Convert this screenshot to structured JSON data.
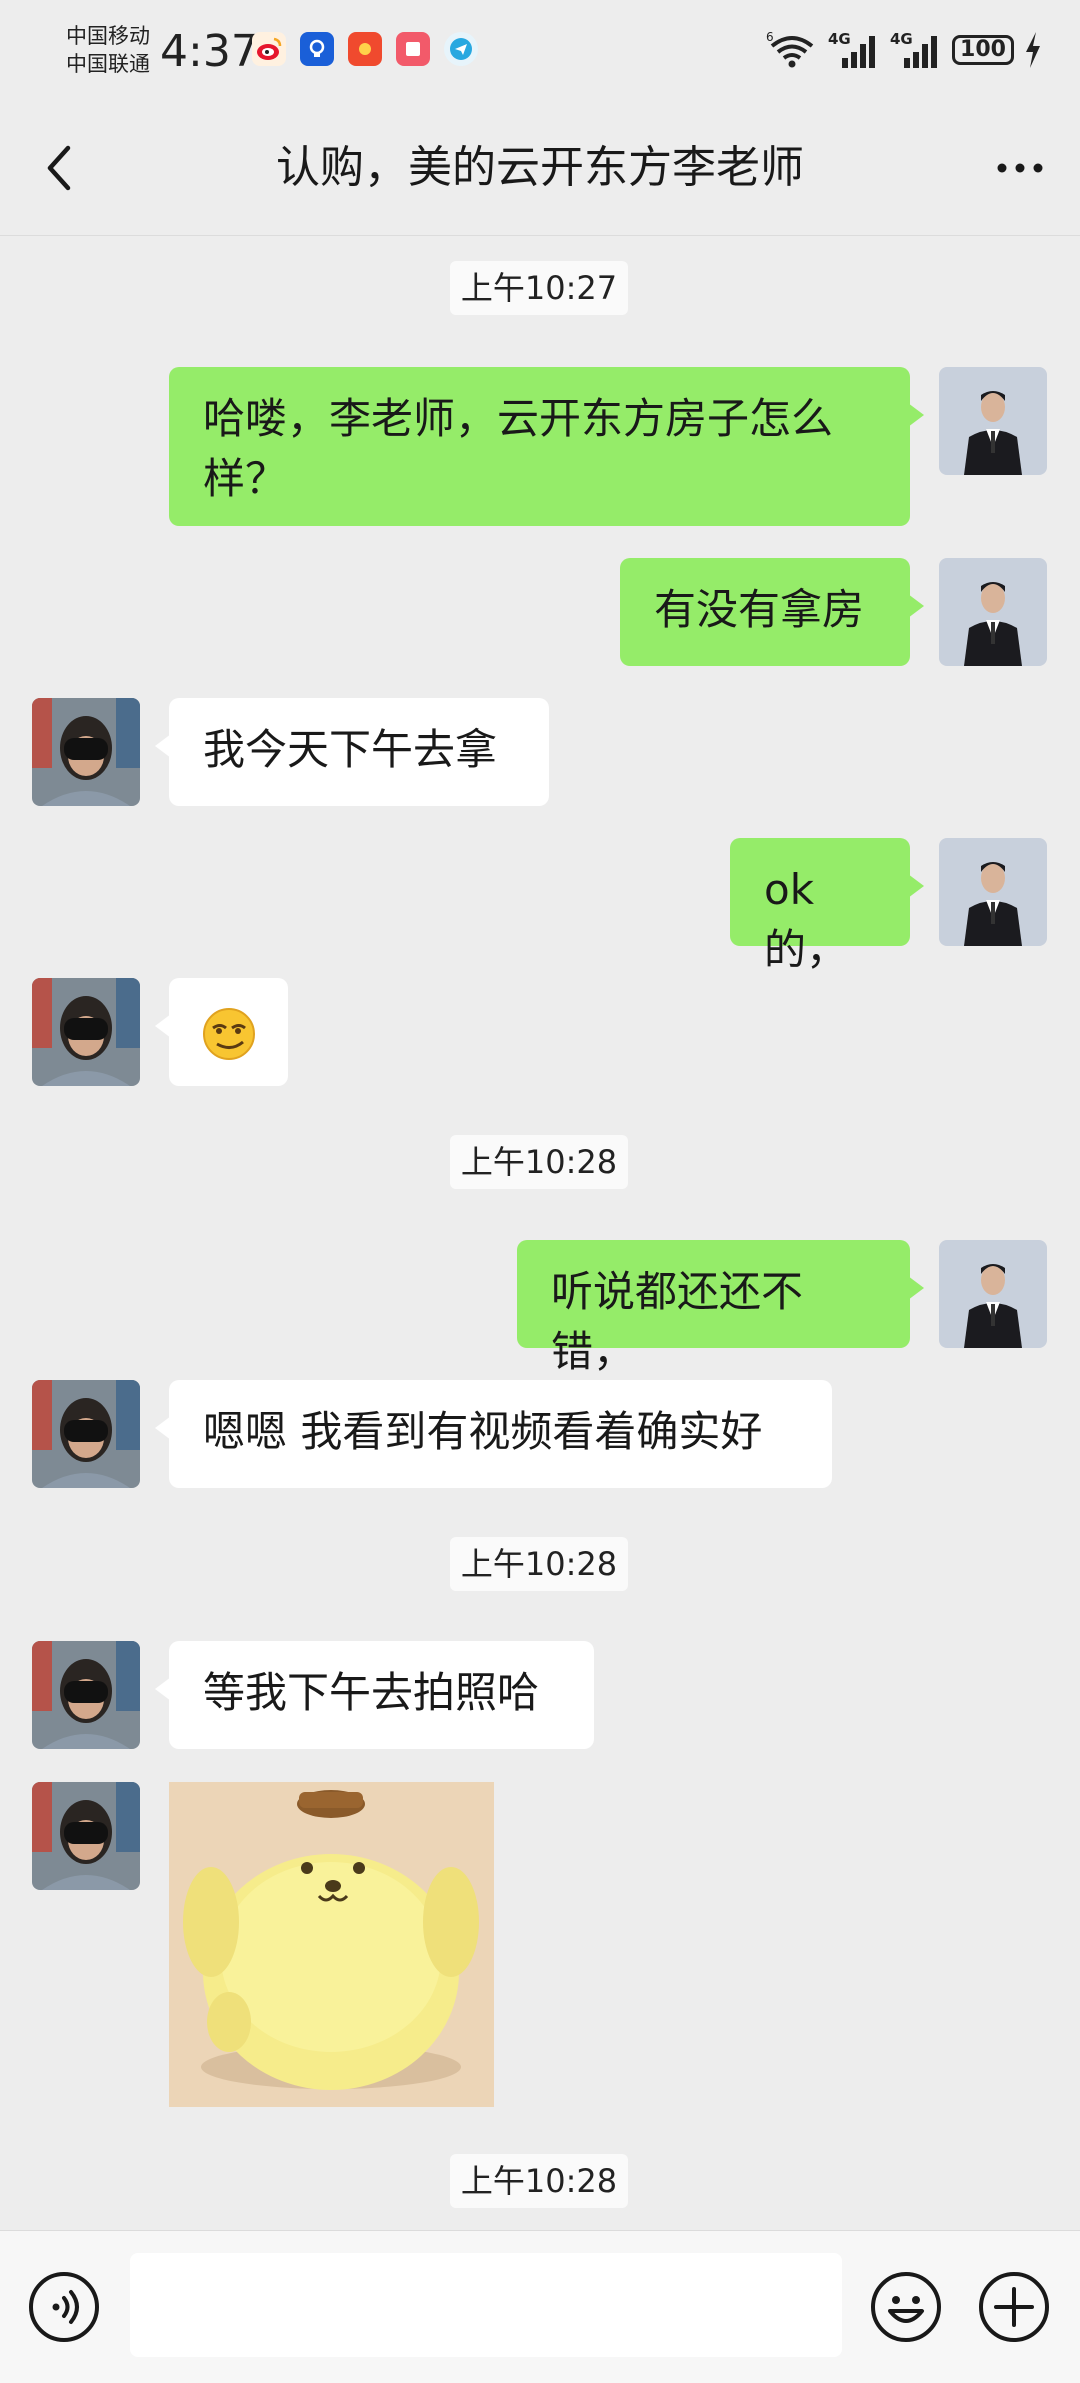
{
  "status_bar": {
    "carrier_1": "中国移动",
    "carrier_2": "中国联通",
    "time": "4:37",
    "network_1": "4G",
    "network_2": "4G",
    "wifi_badge": "6",
    "battery": "100"
  },
  "header": {
    "title": "认购，美的云开东方李老师"
  },
  "messages": {
    "t1": "上午10:27",
    "m1": "哈喽，李老师，云开东方房子怎么样？",
    "m2": "有没有拿房",
    "m3": "我今天下午去拿",
    "m4": "ok 的，",
    "m5_emoji": "😏",
    "t2": "上午10:28",
    "m6": "听说都还还不错，",
    "m7": "嗯嗯 我看到有视频看着确实好",
    "t3": "上午10:28",
    "m8": "等我下午去拍照哈",
    "t4": "上午10:28"
  },
  "colors": {
    "outgoing_bubble": "#95ec69",
    "incoming_bubble": "#ffffff",
    "background": "#ededed"
  },
  "input": {
    "placeholder": ""
  }
}
